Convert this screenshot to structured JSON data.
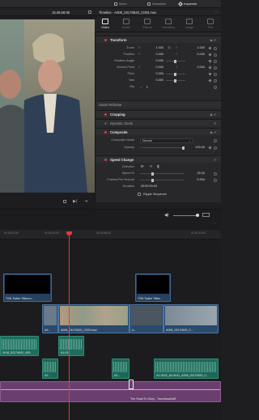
{
  "topbar": {
    "items": [
      {
        "label": "Mixer"
      },
      {
        "label": "Metadata"
      },
      {
        "label": "Inspector"
      }
    ]
  },
  "subbar": {
    "timecode": "16:45:58:06",
    "timeline_name": "Timeline - A008_03170620_C003.mov"
  },
  "inspector": {
    "tabs": [
      "Video",
      "Audio",
      "Effects",
      "Transition",
      "Image",
      "File"
    ],
    "sections": {
      "transform": "Transform",
      "smart_reframe": "Smart Reframe",
      "cropping": "Cropping",
      "dynamic_zoom": "Dynamic Zoom",
      "composite": "Composite",
      "speed_change": "Speed Change"
    },
    "transform_rows": [
      {
        "label": "Zoom",
        "x": "1.000",
        "y": "1.000"
      },
      {
        "label": "Position",
        "x": "0.000",
        "y": "0.000"
      },
      {
        "label": "Rotation Angle",
        "x": "0.000"
      },
      {
        "label": "Anchor Point",
        "x": "0.000",
        "y": "0.000"
      },
      {
        "label": "Pitch",
        "x": "0.000"
      },
      {
        "label": "Yaw",
        "x": "0.000"
      },
      {
        "label": "Flip",
        "x": ""
      }
    ],
    "composite_mode_label": "Composite Mode",
    "composite_mode_value": "Normal",
    "opacity_label": "Opacity",
    "opacity_value": "100.00",
    "speed": {
      "direction_label": "Direction",
      "speed_label": "Speed %",
      "speed_value": "25.00",
      "fps_label": "Frames Per Second",
      "fps_value": "5.994",
      "duration_label": "Duration",
      "duration_value": "00:00:00:00",
      "ripple_label": "Ripple Sequence"
    }
  },
  "timeline": {
    "ruler_tcs": [
      "01:00:22:00",
      "01:00:42:00",
      "01:00:58:00",
      "01:01:14:00"
    ],
    "clips": {
      "title1": "TSN Trailer Titles.m...",
      "title2": "TSN Trailer Titles...",
      "v_main": "A008_03170620_C003.mov",
      "v_a2": "A0...",
      "v_a3": "A...",
      "v_right": "A008_03170620_C...",
      "a1_1": "0018_03170620_005...",
      "a1_2": "A1:03...",
      "a2_1": "A2...",
      "a2_2": "A2...",
      "a2_3": "A2-0023_A3-0041_A008_03170620_C...",
      "music": "The Road To Glory - Touchstudi.aiff"
    }
  },
  "colors": {
    "accent": "#e23b3b",
    "video": "#2a4a6c",
    "audio": "#1f6b5c",
    "music": "#6a3f6f"
  }
}
